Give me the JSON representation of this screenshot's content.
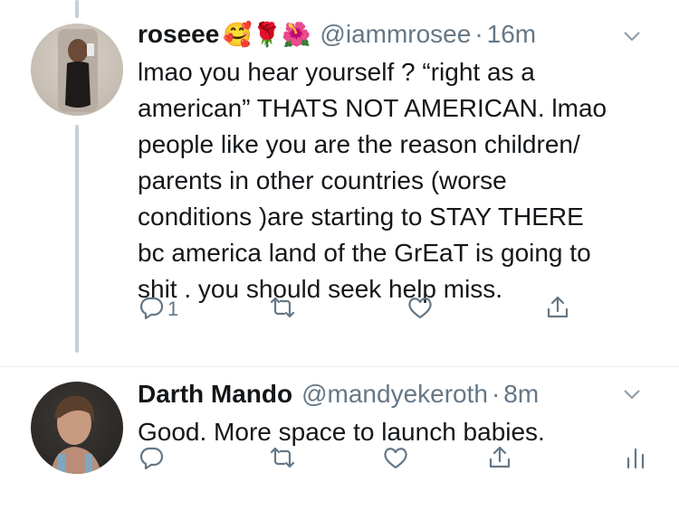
{
  "tweets": [
    {
      "name": "roseee",
      "emojis": "🥰🌹🌺",
      "handle": "@iammrosee",
      "time": "16m",
      "text": "lmao you hear yourself ? “right as a\namerican” THATS NOT AMERICAN. lmao\npeople like you are the reason children/\nparents in other countries (worse\nconditions )are starting to STAY THERE\nbc america land of the GrEaT is going to\nshit . you should seek help miss.",
      "reply_count": "1",
      "icons": [
        "reply-icon",
        "retweet-icon",
        "like-icon",
        "share-icon"
      ]
    },
    {
      "name": "Darth Mando",
      "handle": "@mandyekeroth",
      "time": "8m",
      "text": "Good. More space to launch babies.",
      "reply_count": "",
      "icons": [
        "reply-icon",
        "retweet-icon",
        "like-icon",
        "share-icon",
        "analytics-icon"
      ]
    }
  ],
  "separator": "·",
  "colors": {
    "text": "#14171a",
    "secondary": "#657786",
    "thread_line": "#c7cfd6"
  }
}
